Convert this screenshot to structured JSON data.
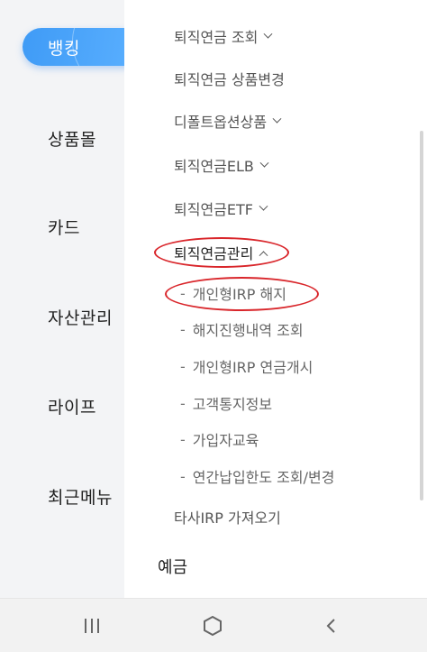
{
  "left_nav": {
    "items": [
      {
        "label": "뱅킹",
        "active": true
      },
      {
        "label": "상품몰"
      },
      {
        "label": "카드"
      },
      {
        "label": "자산관리"
      },
      {
        "label": "라이프"
      },
      {
        "label": "최근메뉴"
      }
    ]
  },
  "menu": {
    "items": [
      {
        "label": "퇴직연금 조회",
        "chevron": "down"
      },
      {
        "label": "퇴직연금 상품변경"
      },
      {
        "label": "디폴트옵션상품",
        "chevron": "down"
      },
      {
        "label": "퇴직연금ELB",
        "chevron": "down"
      },
      {
        "label": "퇴직연금ETF",
        "chevron": "down"
      },
      {
        "label": "퇴직연금관리",
        "chevron": "up"
      }
    ],
    "sub_items": [
      {
        "label": "개인형IRP 해지"
      },
      {
        "label": "해지진행내역 조회"
      },
      {
        "label": "개인형IRP 연금개시"
      },
      {
        "label": "고객통지정보"
      },
      {
        "label": "가입자교육"
      },
      {
        "label": "연간납입한도 조회/변경"
      }
    ],
    "extra_item": {
      "label": "타사IRP 가져오기"
    },
    "category": {
      "label": "예금"
    },
    "dash": "-"
  },
  "annotation": {
    "color": "#d9262b"
  },
  "colors": {
    "accent": "#4aa3f8"
  },
  "system_nav": {
    "recent_icon": "recent-apps-icon",
    "home_icon": "home-icon",
    "back_icon": "back-icon"
  }
}
